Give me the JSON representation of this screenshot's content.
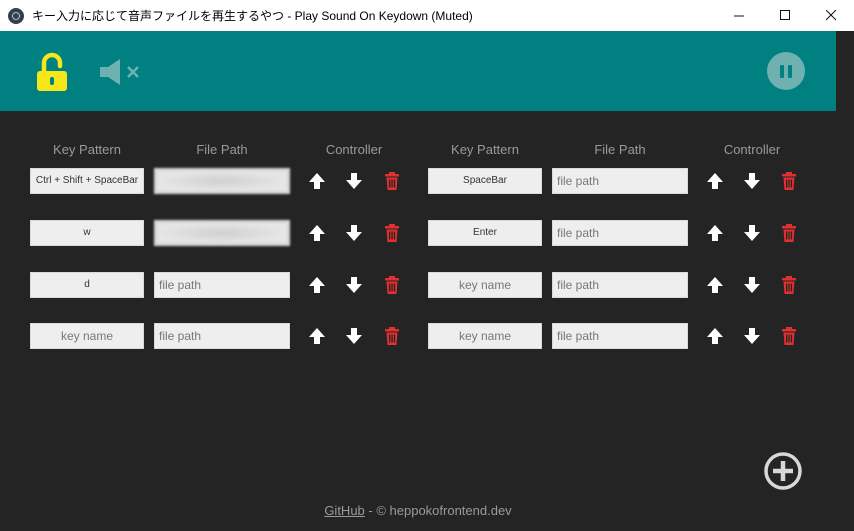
{
  "window": {
    "title": "キー入力に応じて音声ファイルを再生するやつ - Play Sound On Keydown (Muted)",
    "minimize": "minimize",
    "maximize": "maximize",
    "close": "close"
  },
  "header": {
    "lock_icon": "unlocked-padlock-icon",
    "mute_icon": "speaker-muted-icon",
    "pause_icon": "pause-icon",
    "accent_color": "#008080",
    "lock_color": "#f5e71a"
  },
  "columns": {
    "key_pattern": "Key Pattern",
    "file_path": "File Path",
    "controller": "Controller"
  },
  "placeholders": {
    "key": "key name",
    "path": "file path"
  },
  "rows_left": [
    {
      "key": "Ctrl + Shift + SpaceBar",
      "path": "",
      "path_blurred": true
    },
    {
      "key": "w",
      "path": "",
      "path_blurred": true
    },
    {
      "key": "d",
      "path": "",
      "path_blurred": false
    },
    {
      "key": "",
      "path": "",
      "path_blurred": false
    }
  ],
  "rows_right": [
    {
      "key": "SpaceBar",
      "path": "",
      "path_blurred": false
    },
    {
      "key": "Enter",
      "path": "",
      "path_blurred": false
    },
    {
      "key": "",
      "path": "",
      "path_blurred": false
    },
    {
      "key": "",
      "path": "",
      "path_blurred": false
    }
  ],
  "controls": {
    "up_icon": "arrow-up-icon",
    "down_icon": "arrow-down-icon",
    "delete_icon": "trash-icon",
    "delete_color": "#e03030"
  },
  "add_icon": "plus-circle-icon",
  "footer": {
    "link": "GitHub",
    "text": " - © heppokofrontend.dev"
  }
}
